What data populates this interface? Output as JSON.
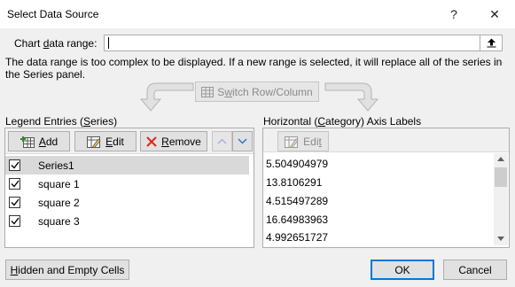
{
  "window": {
    "title": "Select Data Source",
    "help_glyph": "?",
    "close_glyph": "✕"
  },
  "range": {
    "label_pre": "Chart ",
    "label_u": "d",
    "label_post": "ata range:",
    "value": ""
  },
  "message": "The data range is too complex to be displayed. If a new range is selected, it will replace all of the series in the Series panel.",
  "switch_button": {
    "pre": "S",
    "u": "w",
    "post": "itch Row/Column"
  },
  "legend": {
    "label_pre": "Legend Entries (",
    "label_u": "S",
    "label_post": "eries)",
    "add_u": "A",
    "add_post": "dd",
    "edit_u": "E",
    "edit_post": "dit",
    "remove_u": "R",
    "remove_post": "emove",
    "series": [
      {
        "name": "Series1",
        "checked": true,
        "selected": true
      },
      {
        "name": "square 1",
        "checked": true,
        "selected": false
      },
      {
        "name": "square 2",
        "checked": true,
        "selected": false
      },
      {
        "name": "square 3",
        "checked": true,
        "selected": false
      }
    ]
  },
  "axis": {
    "label_pre": "Horizontal (",
    "label_u": "C",
    "label_post": "ategory) Axis Labels",
    "edit_pre": "Edi",
    "edit_u": "t",
    "values": [
      "5.504904979",
      "13.8106291",
      "4.515497289",
      "16.64983963",
      "4.992651727"
    ]
  },
  "footer": {
    "hidden_u": "H",
    "hidden_post": "idden and Empty Cells",
    "ok": "OK",
    "cancel": "Cancel"
  },
  "colors": {
    "remove_icon": "#d9261c",
    "arrow_icon": "#2b79d0",
    "ok_border": "#0078d7"
  }
}
